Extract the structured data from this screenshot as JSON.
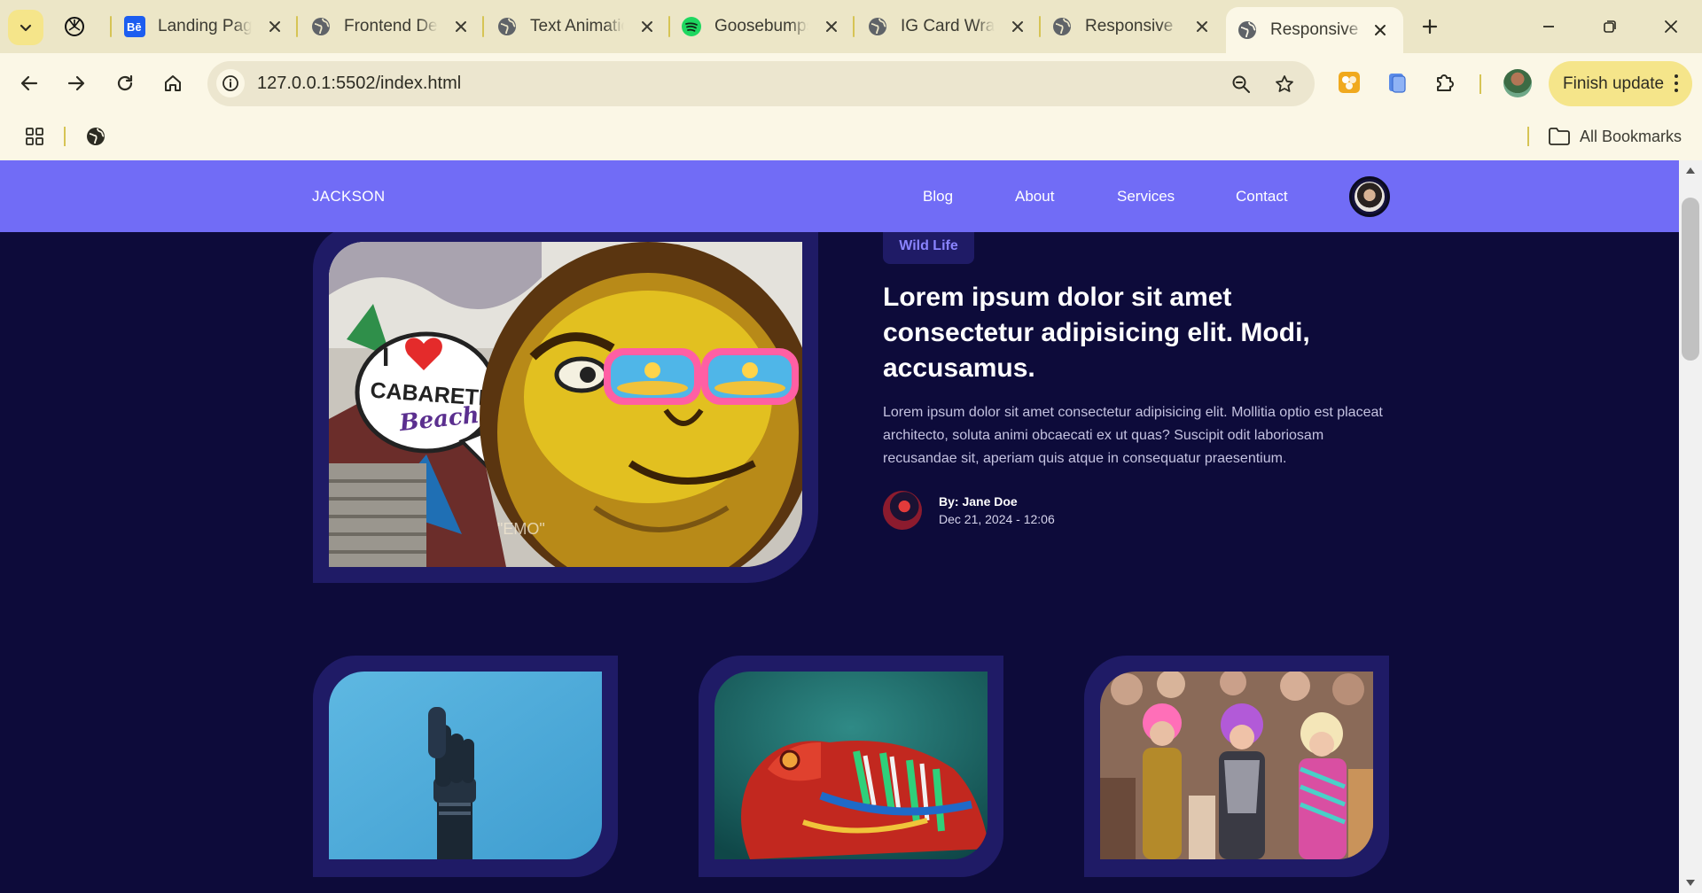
{
  "browser": {
    "tabs": [
      {
        "title": "",
        "icon": "openai-icon"
      },
      {
        "title": "Landing Page",
        "icon": "behance-icon"
      },
      {
        "title": "Frontend Dev",
        "icon": "globe-icon"
      },
      {
        "title": "Text Animatio",
        "icon": "globe-icon"
      },
      {
        "title": "Goosebumps",
        "icon": "spotify-icon"
      },
      {
        "title": "IG Card Wrap",
        "icon": "globe-icon"
      },
      {
        "title": "Responsive D",
        "icon": "globe-icon"
      },
      {
        "title": "Responsive B",
        "icon": "globe-icon",
        "active": true
      }
    ],
    "url": "127.0.0.1:5502/index.html",
    "finish_update_label": "Finish update",
    "all_bookmarks_label": "All Bookmarks",
    "accent_color": "#f5e58a"
  },
  "site": {
    "brand": "JACKSON",
    "nav": [
      "Blog",
      "About",
      "Services",
      "Contact"
    ],
    "nav_color": "#716cf6",
    "background_color": "#0d0b3a"
  },
  "featured": {
    "tag": "Wild Life",
    "headline": "Lorem ipsum dolor sit amet consectetur adipisicing elit. Modi, accusamus.",
    "excerpt": "Lorem ipsum dolor sit amet consectetur adipisicing elit. Mollitia optio est placeat architecto, soluta animi obcaecati ex ut quas? Suscipit odit laboriosam recusandae sit, aperiam quis atque in consequatur praesentium.",
    "author": "By: Jane Doe",
    "date": "Dec 21, 2024 - 12:06",
    "image_art_text": [
      "I",
      "CABARETE",
      "Beach"
    ]
  },
  "cards": [
    {
      "image": "robotic-hand"
    },
    {
      "image": "chameleon"
    },
    {
      "image": "parade-crowd"
    }
  ]
}
